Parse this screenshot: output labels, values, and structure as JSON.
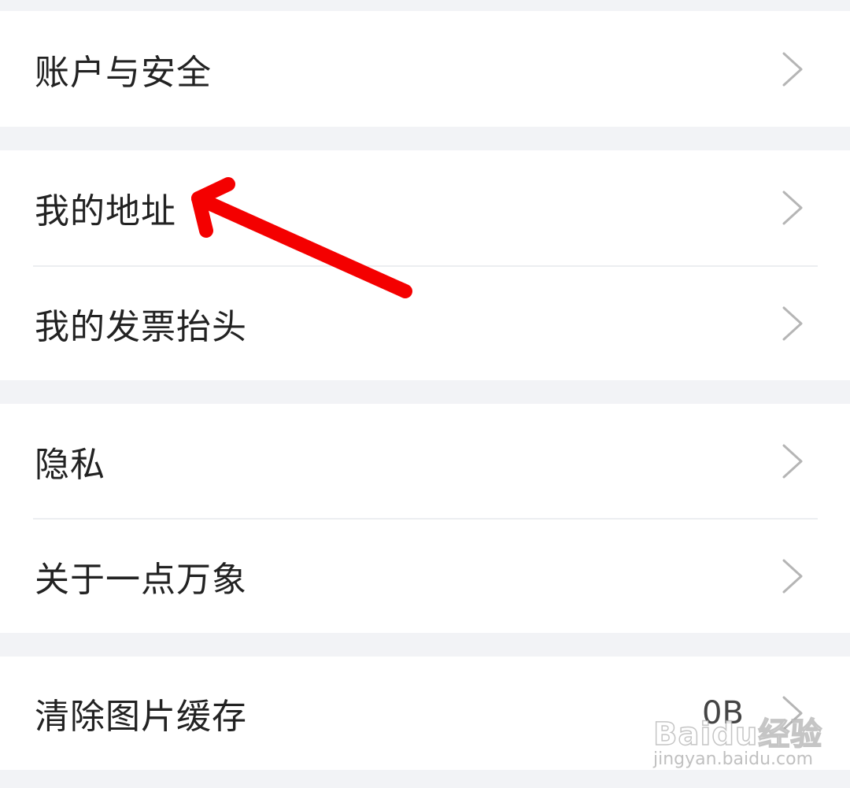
{
  "settings": {
    "items": [
      {
        "label": "账户与安全"
      },
      {
        "label": "我的地址"
      },
      {
        "label": "我的发票抬头"
      },
      {
        "label": "隐私"
      },
      {
        "label": "关于一点万象"
      },
      {
        "label": "清除图片缓存",
        "value": "0B"
      }
    ]
  },
  "watermark": {
    "logo": "Baidu经验",
    "url": "jingyan.baidu.com"
  },
  "colors": {
    "page_background": "#f2f3f6",
    "row_background": "#ffffff",
    "label_text": "#222222",
    "chevron": "#b5b5b5",
    "annotation_arrow": "#f40000"
  },
  "icons": {
    "chevron": "chevron-right-icon",
    "annotation": "red-arrow-annotation"
  }
}
